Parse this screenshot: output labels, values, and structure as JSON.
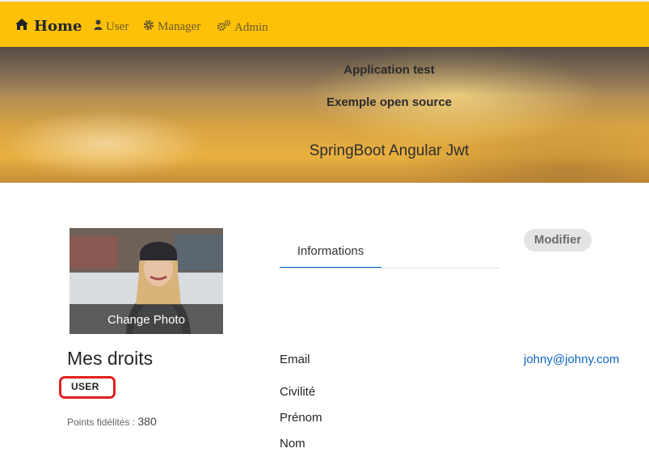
{
  "navbar": {
    "home_label": "Home",
    "user_label": "User",
    "manager_label": "Manager",
    "admin_label": "Admin",
    "background_color": "#ffc107"
  },
  "banner": {
    "title_1": "Application test",
    "title_2": "Exemple open source",
    "subtitle": "SpringBoot Angular Jwt"
  },
  "profile": {
    "change_photo_label": "Change Photo",
    "rights_title": "Mes droits",
    "role_badge": "USER",
    "points_label": "Points fidélités :",
    "points_value": "380"
  },
  "tabs": [
    {
      "label": "Informations",
      "active": true
    }
  ],
  "edit_button_label": "Modifier",
  "details": {
    "email_label": "Email",
    "email_value": "johny@johny.com",
    "civility_label": "Civilité",
    "firstname_label": "Prénom",
    "lastname_label": "Nom"
  },
  "icons": {
    "home": "home-icon",
    "user": "user-icon",
    "manager": "gear-icon",
    "admin": "gears-icon"
  },
  "colors": {
    "accent": "#0062cc",
    "link": "#0d63c8",
    "highlight": "#e02020"
  }
}
